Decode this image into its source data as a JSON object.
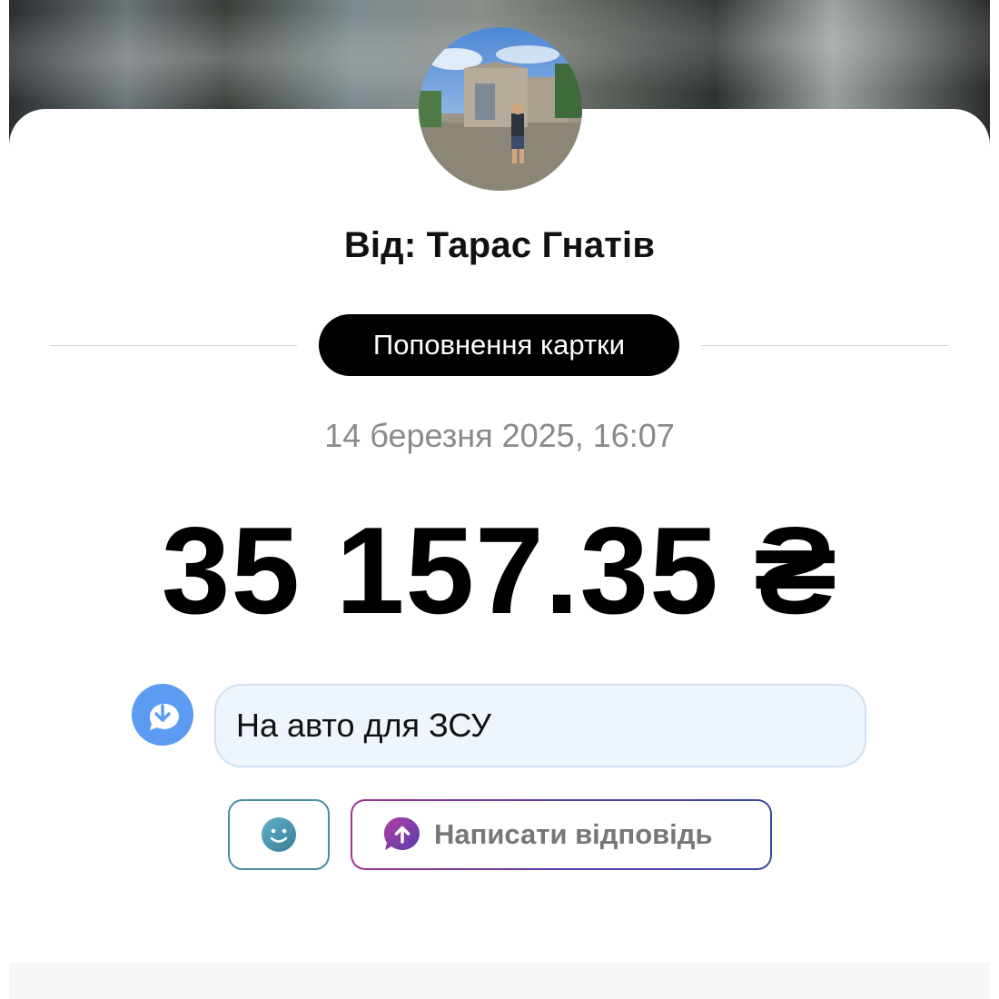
{
  "sender": {
    "label": "Від: Тарас Гнатів"
  },
  "transaction": {
    "type_label": "Поповнення картки",
    "datetime": "14 березня 2025, 16:07",
    "amount": "35 157.35 ₴"
  },
  "message": {
    "text": "На авто для ЗСУ"
  },
  "actions": {
    "reply_label": "Написати відповідь"
  },
  "colors": {
    "amount": "#000000",
    "pill_bg": "#000000",
    "bubble_bg": "#eef5fd",
    "incoming_icon": "#5b9cf2",
    "reply_gradient_start": "#a0338f",
    "reply_gradient_end": "#3b4aa6"
  },
  "icons": {
    "incoming": "arrow-down-chat-icon",
    "emoji": "smile-icon",
    "reply": "arrow-up-chat-icon"
  }
}
